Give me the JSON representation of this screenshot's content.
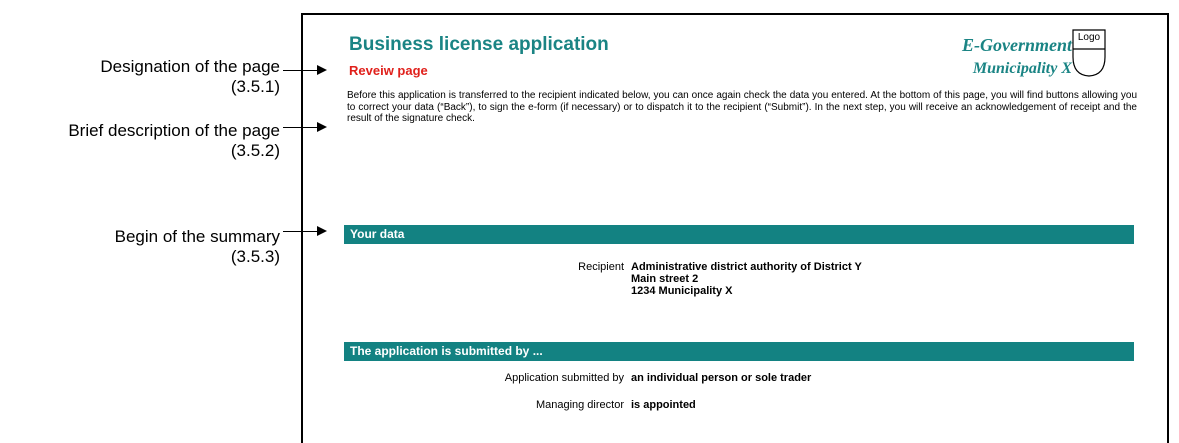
{
  "annotations": [
    {
      "label": "Designation of the page",
      "ref": "(3.5.1)"
    },
    {
      "label": "Brief description of the page",
      "ref": "(3.5.2)"
    },
    {
      "label": "Begin of the summary",
      "ref": "(3.5.3)"
    }
  ],
  "page": {
    "title": "Business license application",
    "subtitle": "Reveiw page",
    "egov": "E-Government",
    "municipality": "Municipality X",
    "logo_label": "Logo",
    "description": "Before this application is transferred to the recipient indicated below, you can once again check the data you entered. At the bottom of this page, you will find buttons allowing you to correct your data (“Back”), to sign the e-form (if necessary) or to dispatch it to the recipient (“Submit”). In the next step, you will receive an acknowledgement of receipt and the result of the signature check.",
    "section_your_data": "Your data",
    "recipient_label": "Recipient",
    "recipient_lines": [
      "Administrative district authority of District Y",
      "Main street 2",
      "1234 Municipality X"
    ],
    "section_submitted": "The application is submitted by ...",
    "submitted_by_label": "Application submitted by",
    "submitted_by_value": "an individual person or sole trader",
    "managing_director_label": "Managing director",
    "managing_director_value": "is appointed"
  },
  "colors": {
    "accent": "#138282",
    "title": "#1a8484",
    "subtitle": "#e0201b"
  }
}
